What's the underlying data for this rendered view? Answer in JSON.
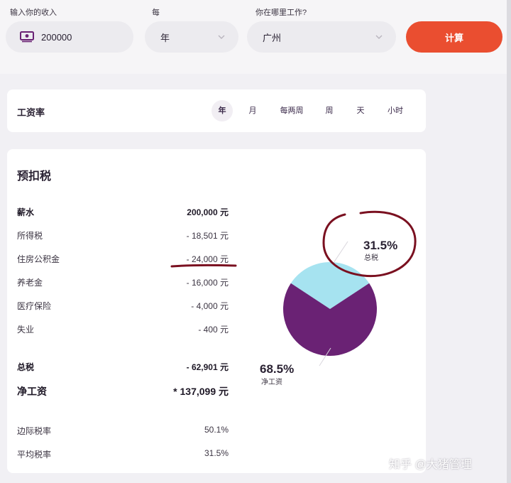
{
  "inputs": {
    "income_label": "输入你的收入",
    "income_value": "200000",
    "period_label": "每",
    "period_value": "年",
    "city_label": "你在哪里工作?",
    "city_value": "广州",
    "calculate_button": "计算"
  },
  "rate_card": {
    "title": "工资率",
    "tabs": [
      {
        "label": "年",
        "active": true
      },
      {
        "label": "月",
        "active": false
      },
      {
        "label": "每两周",
        "active": false
      },
      {
        "label": "周",
        "active": false
      },
      {
        "label": "天",
        "active": false
      },
      {
        "label": "小时",
        "active": false
      }
    ]
  },
  "tax_card": {
    "title": "预扣税",
    "rows": [
      {
        "label": "薪水",
        "value": "200,000 元"
      },
      {
        "label": "所得税",
        "value": "- 18,501 元"
      },
      {
        "label": "住房公积金",
        "value": "- 24,000 元"
      },
      {
        "label": "养老金",
        "value": "- 16,000 元"
      },
      {
        "label": "医疗保险",
        "value": "- 4,000 元"
      },
      {
        "label": "失业",
        "value": "- 400 元"
      }
    ],
    "total_tax": {
      "label": "总税",
      "value": "- 62,901 元"
    },
    "net_pay": {
      "label": "净工资",
      "value": "* 137,099 元"
    },
    "marginal_rate": {
      "label": "边际税率",
      "value": "50.1%"
    },
    "average_rate": {
      "label": "平均税率",
      "value": "31.5%"
    }
  },
  "pie": {
    "tax_percent": 31.5,
    "net_percent": 68.5,
    "tax_pct_text": "31.5%",
    "tax_label": "总税",
    "net_pct_text": "68.5%",
    "net_label": "净工资",
    "tax_color": "#a6e3f0",
    "net_color": "#6a2274"
  },
  "colors": {
    "accent": "#ea4e30",
    "annotation": "#7a1020"
  },
  "watermark": "知乎 @大猪管理"
}
